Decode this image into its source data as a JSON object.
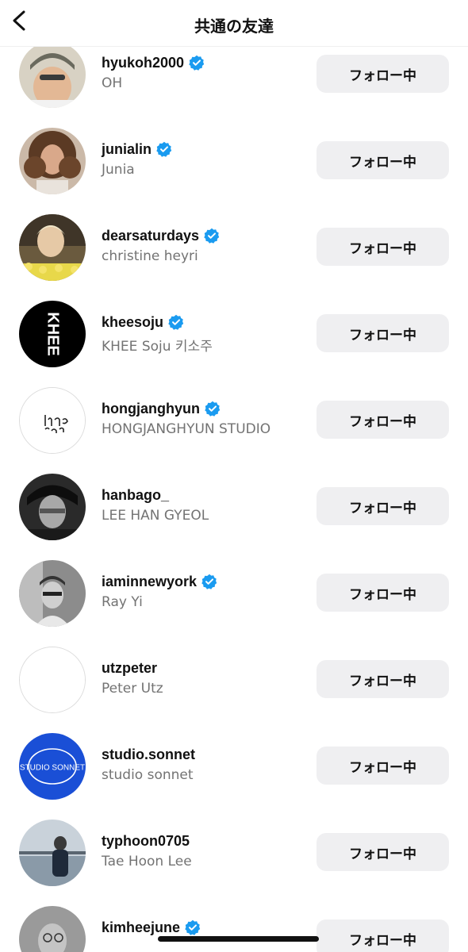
{
  "header": {
    "title": "共通の友達",
    "back_icon": "chevron-left-icon"
  },
  "follow_label": "フォロー中",
  "accent_verified": "#1a9bf0",
  "users": [
    {
      "username": "hyukoh2000",
      "name": "OH",
      "verified": true
    },
    {
      "username": "junialin",
      "name": "Junia",
      "verified": true
    },
    {
      "username": "dearsaturdays",
      "name": "christine heyri",
      "verified": true
    },
    {
      "username": "kheesoju",
      "name": "KHEE Soju  키소주",
      "verified": true,
      "avatar_text": "KHEE"
    },
    {
      "username": "hongjanghyun",
      "name": "HONGJANGHYUN STUDIO",
      "verified": true
    },
    {
      "username": "hanbago_",
      "name": "LEE HAN GYEOL",
      "verified": false
    },
    {
      "username": "iaminnewyork",
      "name": "Ray Yi",
      "verified": true
    },
    {
      "username": "utzpeter",
      "name": "Peter Utz",
      "verified": false
    },
    {
      "username": "studio.sonnet",
      "name": "studio sonnet",
      "verified": false,
      "avatar_text": "STUDIO SONNET"
    },
    {
      "username": "typhoon0705",
      "name": "Tae Hoon Lee",
      "verified": false
    },
    {
      "username": "kimheejune",
      "name": "",
      "verified": true
    }
  ]
}
